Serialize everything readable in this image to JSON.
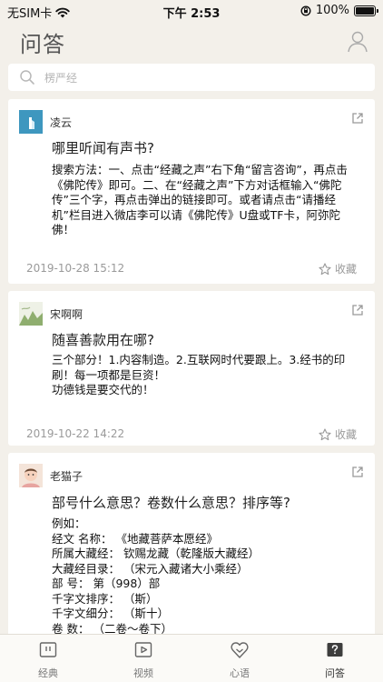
{
  "status_bar": {
    "carrier": "无SIM卡",
    "time": "下午 2:53",
    "battery": "100%"
  },
  "header": {
    "title": "问答"
  },
  "search": {
    "placeholder": "楞严经",
    "value": ""
  },
  "cards": [
    {
      "username": "凌云",
      "question": "哪里听闻有声书?",
      "answer": "搜索方法：一、点击“经藏之声”右下角“留言咨询”，再点击《佛陀传》即可。二、在“经藏之声”下方对话框输入“佛陀传”三个字，再点击弹出的链接即可。或者请点击“请播经机”栏目进入微店李可以请《佛陀传》U盘或TF卡，阿弥陀佛！",
      "date": "2019-10-28 15:12",
      "favorite_label": "收藏"
    },
    {
      "username": "宋啊啊",
      "question": "随喜善款用在哪?",
      "answer": "三个部分！1.内容制造。2.互联网时代要跟上。3.经书的印刷！每一项都是巨资！\n功德钱是要交代的！",
      "date": "2019-10-22 14:22",
      "favorite_label": "收藏"
    },
    {
      "username": "老猫子",
      "question": "部号什么意思？卷数什么意思？排序等?",
      "answer": "例如：\n经文  名称：  《地藏菩萨本愿经》\n所属大藏经：  钦赐龙藏（乾隆版大藏经）\n大藏经目录：  （宋元入藏诸大小乘经）\n部      号：  第（998）部\n千字文排序：  （斯）\n千字文细分：  （斯十）\n卷      数：  （二卷～卷下）"
    }
  ],
  "tabs": [
    {
      "label": "经典",
      "icon": "book-icon"
    },
    {
      "label": "视频",
      "icon": "video-play-icon"
    },
    {
      "label": "心语",
      "icon": "heart-icon"
    },
    {
      "label": "问答",
      "icon": "question-icon",
      "active": true
    }
  ]
}
